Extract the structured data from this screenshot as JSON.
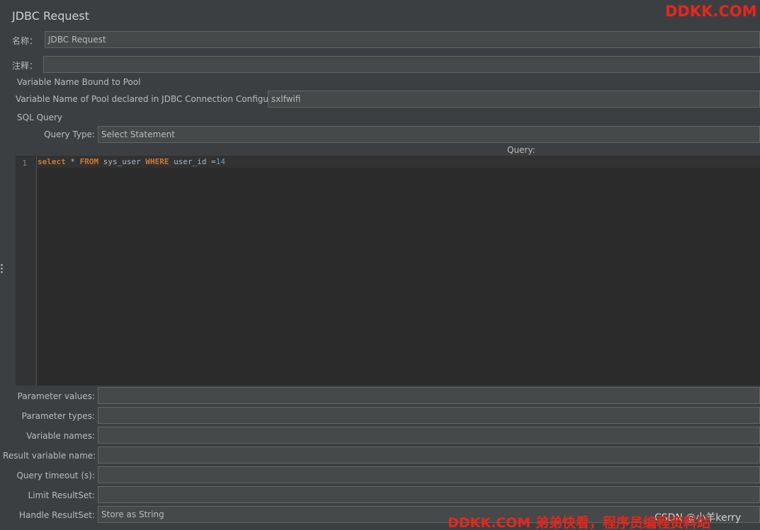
{
  "panel": {
    "title": "JDBC Request",
    "name_label": "名称：",
    "name_value": "JDBC Request",
    "comment_label": "注释：",
    "comment_value": ""
  },
  "pool_section": {
    "title": "Variable Name Bound to Pool",
    "pool_label": "Variable Name of Pool declared in JDBC Connection Configuration:",
    "pool_value": "sxlfwifi"
  },
  "sql_section": {
    "title": "SQL Query",
    "query_type_label": "Query Type:",
    "query_type_value": "Select Statement",
    "query_label": "Query:",
    "editor": {
      "line_number": "1",
      "tokens": [
        {
          "text": "select",
          "kind": "keyword"
        },
        {
          "text": " * ",
          "kind": "plain"
        },
        {
          "text": "FROM",
          "kind": "keyword"
        },
        {
          "text": " sys_user ",
          "kind": "plain"
        },
        {
          "text": "WHERE",
          "kind": "keyword"
        },
        {
          "text": " user_id =",
          "kind": "plain"
        },
        {
          "text": "14",
          "kind": "number"
        }
      ]
    }
  },
  "params": {
    "parameter_values_label": "Parameter values:",
    "parameter_values": "",
    "parameter_types_label": "Parameter types:",
    "parameter_types": "",
    "variable_names_label": "Variable names:",
    "variable_names": "",
    "result_variable_name_label": "Result variable name:",
    "result_variable_name": "",
    "query_timeout_label": "Query timeout (s):",
    "query_timeout": "",
    "limit_resultset_label": "Limit ResultSet:",
    "limit_resultset": "",
    "handle_resultset_label": "Handle ResultSet:",
    "handle_resultset_value": "Store as String"
  },
  "watermarks": {
    "top_right": "DDKK.COM",
    "bottom": "DDKK.COM 弟弟快看，程序员编程资料站",
    "csdn": "CSDN @小羊kerry"
  },
  "colors": {
    "background": "#3c3f41",
    "field": "#45494a",
    "editor": "#2b2b2b",
    "keyword": "#cc7832",
    "number": "#6897bb",
    "watermark": "#e8261c"
  }
}
